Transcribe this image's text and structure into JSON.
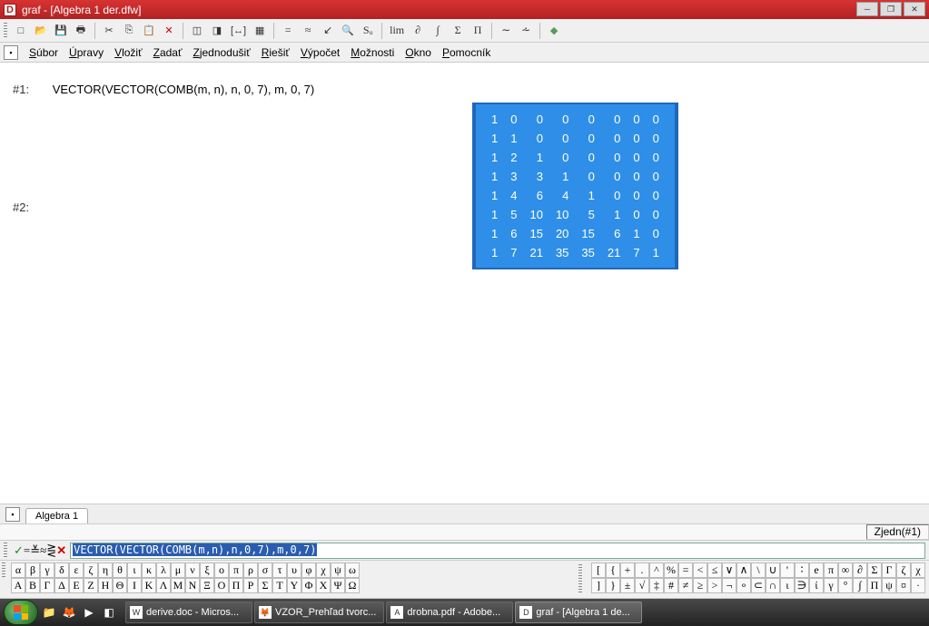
{
  "title": "graf - [Algebra 1  der.dfw]",
  "app_icon_letter": "D",
  "menu": [
    "Súbor",
    "Úpravy",
    "Vložiť",
    "Zadať",
    "Zjednodušiť",
    "Riešiť",
    "Výpočet",
    "Možnosti",
    "Okno",
    "Pomocník"
  ],
  "toolbar1": {
    "new": "□",
    "open": "📂",
    "save": "💾",
    "print": "🖶",
    "cut": "✂",
    "copy": "⎘",
    "paste": "📋",
    "delete": "✕",
    "win1": "◫",
    "win2": "◨",
    "brackets": "[↔]",
    "grid": "▦",
    "equals": "=",
    "approx": "≈",
    "step": "↙",
    "zoom": "🔍",
    "sub": "Sᵤ",
    "lim": "lim",
    "partial": "∂",
    "integral": "∫",
    "sigma": "Σ",
    "pi": "Π",
    "secant": "∼",
    "wave": "⩪",
    "help": "◆"
  },
  "workspace": {
    "line1_label": "#1:",
    "line1_expr": "VECTOR(VECTOR(COMB(m, n), n, 0, 7), m, 0, 7)",
    "line2_label": "#2:"
  },
  "chart_data": {
    "type": "table",
    "title": "Pascal's triangle COMB(m,n) for m,n = 0..7",
    "rows": [
      [
        1,
        0,
        0,
        0,
        0,
        0,
        0,
        0
      ],
      [
        1,
        1,
        0,
        0,
        0,
        0,
        0,
        0
      ],
      [
        1,
        2,
        1,
        0,
        0,
        0,
        0,
        0
      ],
      [
        1,
        3,
        3,
        1,
        0,
        0,
        0,
        0
      ],
      [
        1,
        4,
        6,
        4,
        1,
        0,
        0,
        0
      ],
      [
        1,
        5,
        10,
        10,
        5,
        1,
        0,
        0
      ],
      [
        1,
        6,
        15,
        20,
        15,
        6,
        1,
        0
      ],
      [
        1,
        7,
        21,
        35,
        35,
        21,
        7,
        1
      ]
    ]
  },
  "doc_tab": "Algebra 1",
  "status": "Zjedn(#1)",
  "input_bar": {
    "btns": [
      "✓",
      "=",
      "≚",
      "≈",
      "⋛",
      "✕"
    ],
    "value": "VECTOR(VECTOR(COMB(m,n),n,0,7),m,0,7)"
  },
  "symbols": {
    "lower": [
      "α",
      "β",
      "γ",
      "δ",
      "ε",
      "ζ",
      "η",
      "θ",
      "ι",
      "κ",
      "λ",
      "μ",
      "ν",
      "ξ",
      "ο",
      "π",
      "ρ",
      "σ",
      "τ",
      "υ",
      "φ",
      "χ",
      "ψ",
      "ω"
    ],
    "upper": [
      "Α",
      "Β",
      "Γ",
      "Δ",
      "Ε",
      "Ζ",
      "Η",
      "Θ",
      "Ι",
      "Κ",
      "Λ",
      "Μ",
      "Ν",
      "Ξ",
      "Ο",
      "Π",
      "Ρ",
      "Σ",
      "Τ",
      "Υ",
      "Φ",
      "Χ",
      "Ψ",
      "Ω"
    ],
    "ops1": [
      "[",
      "{",
      "+",
      ".",
      "^",
      "%",
      "=",
      "<",
      "≤",
      "∨",
      "∧",
      "\\",
      "∪",
      "'",
      "∶",
      "e",
      "π",
      "∞",
      "∂",
      "Σ",
      "Γ",
      "ζ",
      "χ"
    ],
    "ops2": [
      "]",
      "}",
      "±",
      "√",
      "‡",
      "#",
      "≠",
      "≥",
      ">",
      "¬",
      "∘",
      "⊂",
      "∩",
      "ι",
      "∋",
      "ί",
      "γ",
      "°",
      "∫",
      "Π",
      "ψ",
      "¤",
      "·"
    ]
  },
  "taskbar": {
    "items": [
      {
        "icon": "W",
        "label": "derive.doc - Micros..."
      },
      {
        "icon": "🦊",
        "label": "VZOR_Prehľad tvorc..."
      },
      {
        "icon": "A",
        "label": "drobna.pdf - Adobe..."
      },
      {
        "icon": "D",
        "label": "graf - [Algebra 1  de..."
      }
    ]
  }
}
